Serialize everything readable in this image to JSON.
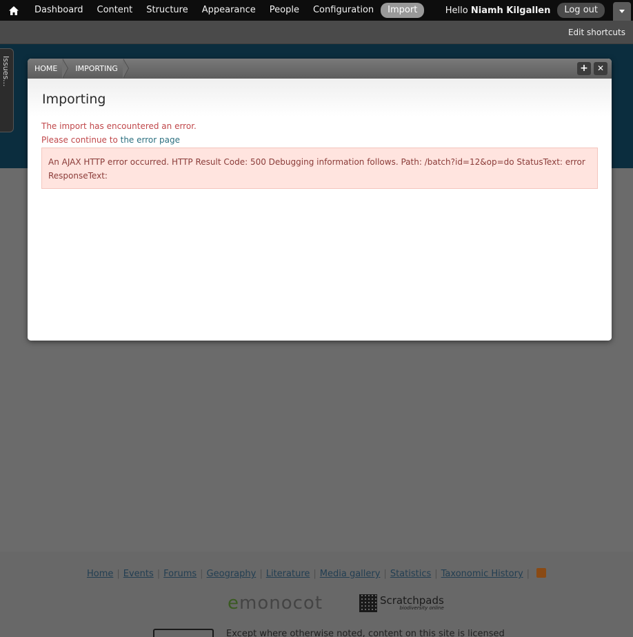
{
  "toolbar": {
    "home_icon": "home-icon",
    "menu": [
      "Dashboard",
      "Content",
      "Structure",
      "Appearance",
      "People",
      "Configuration",
      "Import"
    ],
    "active_item": "Import",
    "hello_prefix": "Hello",
    "user_name": "Niamh Kilgallen",
    "logout_label": "Log out",
    "toggle_icon": "chevron-down-icon"
  },
  "shortcuts": {
    "edit_label": "Edit shortcuts"
  },
  "issues_tab": {
    "label": "Issues..."
  },
  "dialog": {
    "breadcrumbs": [
      "HOME",
      "IMPORTING"
    ],
    "title": "Importing",
    "error_line": "The import has encountered an error.",
    "continue_prefix": "Please continue to",
    "continue_link": "the error page",
    "error_box_text": "An AJAX HTTP error occurred. HTTP Result Code: 500 Debugging information follows. Path: /batch?id=12&op=do StatusText: error ResponseText:"
  },
  "footer": {
    "links": [
      "Home",
      "Events",
      "Forums",
      "Geography",
      "Literature",
      "Media gallery",
      "Statistics",
      "Taxonomic History"
    ],
    "rss_icon": "rss-icon",
    "emonocot_logo": "emonocot",
    "scratchpads_logo": "Scratchpads",
    "scratchpads_sub": "biodiversity online",
    "license_text": "Except where otherwise noted, content on this site is licensed"
  },
  "colors": {
    "toolbar_bg": "#0d0d0d",
    "error_text": "#c0474a",
    "error_box_bg": "#ffe4df",
    "link": "#2b6f7f"
  }
}
